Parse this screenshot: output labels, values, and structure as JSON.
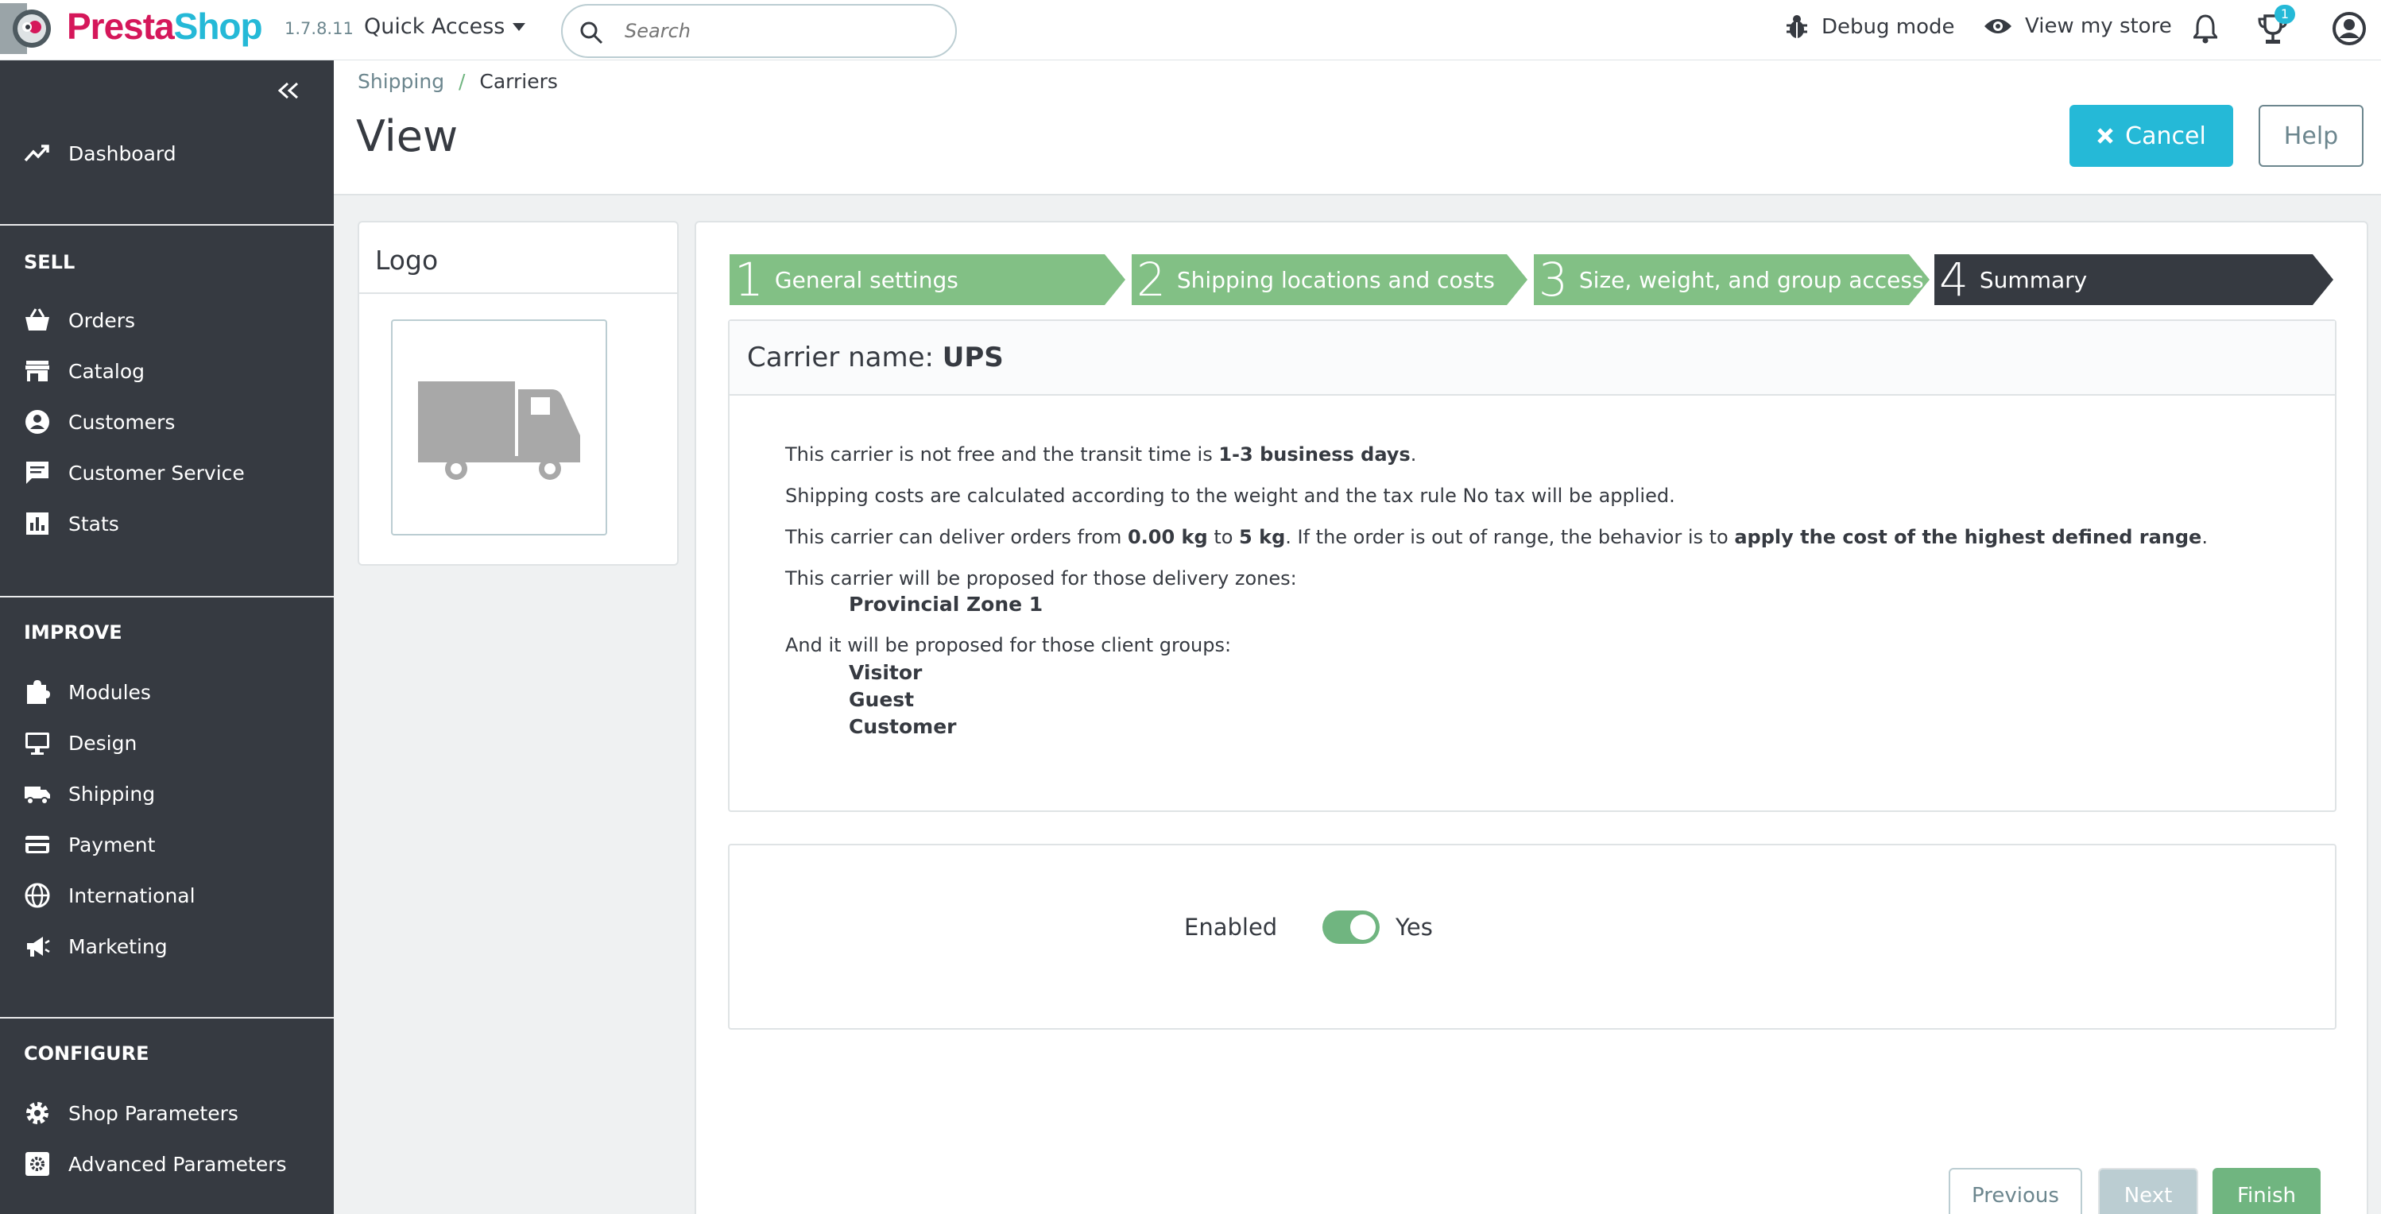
{
  "app": {
    "brand_presta": "Presta",
    "brand_shop": "Shop",
    "version": "1.7.8.11"
  },
  "header": {
    "quick_access": "Quick Access",
    "search_placeholder": "Search",
    "debug_mode": "Debug mode",
    "view_store": "View my store",
    "notification_count": "1"
  },
  "sidebar": {
    "dashboard": "Dashboard",
    "sections": [
      {
        "title": "SELL",
        "items": [
          "Orders",
          "Catalog",
          "Customers",
          "Customer Service",
          "Stats"
        ]
      },
      {
        "title": "IMPROVE",
        "items": [
          "Modules",
          "Design",
          "Shipping",
          "Payment",
          "International",
          "Marketing"
        ]
      },
      {
        "title": "CONFIGURE",
        "items": [
          "Shop Parameters",
          "Advanced Parameters"
        ]
      }
    ]
  },
  "breadcrumb": {
    "parent": "Shipping",
    "separator": "/",
    "current": "Carriers"
  },
  "page": {
    "title": "View",
    "cancel": "Cancel",
    "help": "Help"
  },
  "logo_panel": {
    "title": "Logo"
  },
  "wizard": {
    "steps": [
      {
        "num": "1",
        "label": "General settings"
      },
      {
        "num": "2",
        "label": "Shipping locations and costs"
      },
      {
        "num": "3",
        "label": "Size, weight, and group access"
      },
      {
        "num": "4",
        "label": "Summary"
      }
    ],
    "active_step": 4
  },
  "summary": {
    "carrier_label": "Carrier name:",
    "carrier_name": "UPS",
    "transit_prefix": "This carrier is not free and the transit time is ",
    "transit_time": "1-3 business days",
    "transit_suffix": ".",
    "costs_line": "Shipping costs are calculated according to the weight and the tax rule No tax will be applied.",
    "range_prefix": "This carrier can deliver orders from ",
    "range_min": "0.00 kg",
    "range_to": " to ",
    "range_max": "5 kg",
    "range_mid": ". If the order is out of range, the behavior is to ",
    "range_behavior": "apply the cost of the highest defined range",
    "range_suffix": ".",
    "zones_line": "This carrier will be proposed for those delivery zones:",
    "zones": [
      "Provincial Zone 1"
    ],
    "groups_line": "And it will be proposed for those client groups:",
    "groups": [
      "Visitor",
      "Guest",
      "Customer"
    ]
  },
  "enabled": {
    "label": "Enabled",
    "value": "Yes",
    "state": true
  },
  "footer_buttons": {
    "previous": "Previous",
    "next": "Next",
    "finish": "Finish"
  },
  "colors": {
    "brand_pink": "#d5175a",
    "brand_cyan": "#25b9d7",
    "step_done": "#82c085",
    "step_active": "#363a41",
    "sidebar_bg": "#363a41",
    "toggle_on": "#70b580"
  }
}
